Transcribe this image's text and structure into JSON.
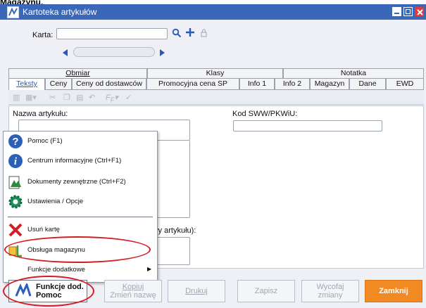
{
  "fragment": "Magazynu.",
  "window": {
    "title": "Kartoteka artykułów"
  },
  "header": {
    "karta_label": "Karta:",
    "karta_value": ""
  },
  "tabs_row1": [
    "Obmiar",
    "Klasy",
    "Notatka"
  ],
  "tabs_row2": [
    "Teksty",
    "Ceny",
    "Ceny od dostawców",
    "Promocyjna cena SP",
    "Info 1",
    "Info 2",
    "Magazyn",
    "Dane",
    "EWD"
  ],
  "fields": {
    "nazwa_label": "Nazwa artykułu:",
    "kod_label": "Kod SWW/PKWiU:",
    "nazwa_ext_label": "azwy artykułu):"
  },
  "menu": {
    "items": [
      {
        "label": "Pomoc (F1)",
        "icon": "help-icon"
      },
      {
        "label": "Centrum informacyjne (Ctrl+F1)",
        "icon": "info-icon"
      },
      {
        "label": "Dokumenty zewnętrzne (Ctrl+F2)",
        "icon": "document-icon"
      },
      {
        "label": "Ustawienia / Opcje",
        "icon": "gear-icon"
      },
      {
        "label": "Usuń kartę",
        "icon": "delete-icon"
      },
      {
        "label": "Obsługa magazynu",
        "icon": "warehouse-icon"
      },
      {
        "label": "Funkcje dodatkowe",
        "icon": "chevron-right-icon"
      }
    ]
  },
  "buttons": {
    "funkcje_line1": "Funkcje dod.",
    "funkcje_line2": "Pomoc",
    "kopiuj_line1": "Kopiuj",
    "kopiuj_line2": "Zmień nazwę",
    "drukuj": "Drukuj",
    "zapisz": "Zapisz",
    "wycofaj_line1": "Wycofaj",
    "wycofaj_line2": "zmiany",
    "zamknij": "Zamknij"
  },
  "colors": {
    "titlebar": "#3a67b8",
    "accent_orange": "#f28a23",
    "highlight_red": "#d41c22"
  }
}
